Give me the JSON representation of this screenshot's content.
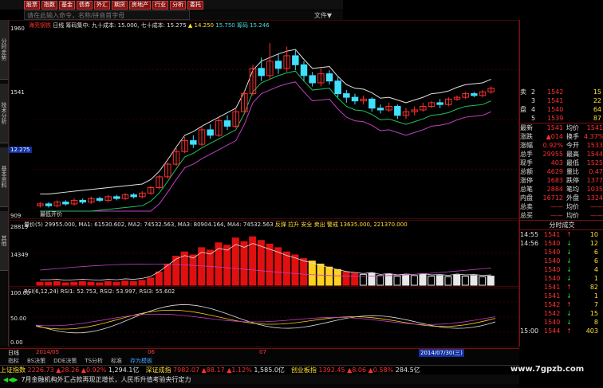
{
  "toolbar": {
    "buttons": [
      "股票",
      "指数",
      "基金",
      "债券",
      "外汇",
      "期货",
      "房地产",
      "行业",
      "分析",
      "委托"
    ],
    "command_placeholder": "请在此输入命令，名称/拼音首字母",
    "file_menu": "文件▼"
  },
  "left_tabs": [
    "分时走势",
    "技术分析",
    "基本资料",
    "其他"
  ],
  "main_chart": {
    "stock_name": "海亮钢铁",
    "period": "日线",
    "indicator_line": "筹码集中: 九十成本: 15.000, 七十成本: 15.275",
    "hi_label": "▲ 14.250",
    "values_line": "15.750 筹码 15.246",
    "y_top": "1960",
    "y_mid": "1541",
    "y_cur": "12.275",
    "y_bottom": "909",
    "bottom_hint": "最低开价",
    "candles": [
      {
        "o": 9.6,
        "c": 9.7,
        "h": 9.8,
        "l": 9.5
      },
      {
        "o": 9.7,
        "c": 9.6,
        "h": 9.8,
        "l": 9.5
      },
      {
        "o": 9.6,
        "c": 9.8,
        "h": 9.9,
        "l": 9.5
      },
      {
        "o": 9.8,
        "c": 9.7,
        "h": 9.9,
        "l": 9.6
      },
      {
        "o": 9.7,
        "c": 9.9,
        "h": 10.0,
        "l": 9.6
      },
      {
        "o": 9.9,
        "c": 9.8,
        "h": 10.0,
        "l": 9.7
      },
      {
        "o": 9.8,
        "c": 10.0,
        "h": 10.1,
        "l": 9.7
      },
      {
        "o": 10.0,
        "c": 9.9,
        "h": 10.1,
        "l": 9.8
      },
      {
        "o": 9.9,
        "c": 10.1,
        "h": 10.2,
        "l": 9.8
      },
      {
        "o": 10.1,
        "c": 10.0,
        "h": 10.2,
        "l": 9.9
      },
      {
        "o": 10.0,
        "c": 10.2,
        "h": 10.3,
        "l": 9.9
      },
      {
        "o": 10.2,
        "c": 10.1,
        "h": 10.3,
        "l": 10.0
      },
      {
        "o": 10.1,
        "c": 10.3,
        "h": 10.4,
        "l": 10.0
      },
      {
        "o": 10.3,
        "c": 10.6,
        "h": 10.7,
        "l": 10.2
      },
      {
        "o": 10.6,
        "c": 11.2,
        "h": 11.3,
        "l": 10.5
      },
      {
        "o": 11.2,
        "c": 11.9,
        "h": 12.0,
        "l": 11.1
      },
      {
        "o": 11.9,
        "c": 12.6,
        "h": 12.8,
        "l": 11.8
      },
      {
        "o": 12.6,
        "c": 13.2,
        "h": 13.4,
        "l": 12.5
      },
      {
        "o": 13.2,
        "c": 13.0,
        "h": 13.5,
        "l": 12.8
      },
      {
        "o": 13.0,
        "c": 13.8,
        "h": 14.0,
        "l": 12.9
      },
      {
        "o": 13.8,
        "c": 13.5,
        "h": 14.1,
        "l": 13.3
      },
      {
        "o": 13.5,
        "c": 14.3,
        "h": 14.5,
        "l": 13.4
      },
      {
        "o": 14.3,
        "c": 14.0,
        "h": 14.6,
        "l": 13.8
      },
      {
        "o": 14.0,
        "c": 14.8,
        "h": 15.0,
        "l": 13.9
      },
      {
        "o": 14.8,
        "c": 15.8,
        "h": 16.0,
        "l": 14.7
      },
      {
        "o": 15.8,
        "c": 17.2,
        "h": 17.4,
        "l": 15.7
      },
      {
        "o": 17.2,
        "c": 16.8,
        "h": 17.8,
        "l": 16.5
      },
      {
        "o": 16.8,
        "c": 17.6,
        "h": 18.6,
        "l": 16.6
      },
      {
        "o": 17.6,
        "c": 17.2,
        "h": 18.0,
        "l": 16.9
      },
      {
        "o": 17.2,
        "c": 17.9,
        "h": 18.4,
        "l": 17.0
      },
      {
        "o": 17.9,
        "c": 17.4,
        "h": 18.2,
        "l": 17.1
      },
      {
        "o": 17.4,
        "c": 16.8,
        "h": 17.6,
        "l": 16.5
      },
      {
        "o": 16.8,
        "c": 16.4,
        "h": 17.0,
        "l": 16.2
      },
      {
        "o": 16.4,
        "c": 16.9,
        "h": 17.2,
        "l": 16.2
      },
      {
        "o": 16.9,
        "c": 16.5,
        "h": 17.1,
        "l": 16.3
      },
      {
        "o": 16.5,
        "c": 15.8,
        "h": 16.7,
        "l": 15.6
      },
      {
        "o": 15.8,
        "c": 15.6,
        "h": 16.0,
        "l": 15.3
      },
      {
        "o": 15.6,
        "c": 15.4,
        "h": 15.8,
        "l": 15.2
      },
      {
        "o": 15.4,
        "c": 15.5,
        "h": 15.7,
        "l": 15.2
      },
      {
        "o": 15.5,
        "c": 15.0,
        "h": 15.6,
        "l": 14.8
      },
      {
        "o": 15.0,
        "c": 14.9,
        "h": 15.2,
        "l": 14.7
      },
      {
        "o": 14.9,
        "c": 15.1,
        "h": 15.3,
        "l": 14.8
      },
      {
        "o": 15.1,
        "c": 14.6,
        "h": 15.2,
        "l": 14.4
      },
      {
        "o": 14.6,
        "c": 14.8,
        "h": 15.0,
        "l": 14.4
      },
      {
        "o": 14.8,
        "c": 14.9,
        "h": 15.1,
        "l": 14.6
      },
      {
        "o": 14.9,
        "c": 15.1,
        "h": 15.3,
        "l": 14.8
      },
      {
        "o": 15.1,
        "c": 15.3,
        "h": 15.4,
        "l": 15.0
      },
      {
        "o": 15.3,
        "c": 15.2,
        "h": 15.5,
        "l": 15.0
      },
      {
        "o": 15.2,
        "c": 15.5,
        "h": 15.6,
        "l": 15.1
      },
      {
        "o": 15.5,
        "c": 15.6,
        "h": 15.7,
        "l": 15.4
      },
      {
        "o": 15.6,
        "c": 15.8,
        "h": 15.9,
        "l": 15.5
      },
      {
        "o": 15.8,
        "c": 15.7,
        "h": 15.9,
        "l": 15.6
      },
      {
        "o": 15.7,
        "c": 15.9,
        "h": 16.0,
        "l": 15.6
      },
      {
        "o": 15.9,
        "c": 16.1,
        "h": 16.2,
        "l": 15.8
      }
    ]
  },
  "volume_panel": {
    "header": "量价(5) 29955.000, MA1: 61530.602, MA2: 74532.563, MA3: 80904.164, MA4: 74532.563",
    "extra": "反弹 拉升 安全 卖出 警戒 13635.000, 221370.000",
    "y_top": "28819",
    "y_mid": "14349",
    "bars": [
      0.05,
      0.05,
      0.06,
      0.04,
      0.05,
      0.06,
      0.05,
      0.04,
      0.06,
      0.05,
      0.07,
      0.06,
      0.08,
      0.12,
      0.22,
      0.35,
      0.48,
      0.55,
      0.5,
      0.62,
      0.58,
      0.7,
      0.66,
      0.78,
      0.72,
      0.8,
      0.74,
      0.68,
      0.62,
      0.55,
      0.5,
      0.44,
      0.4,
      0.35,
      0.3,
      0.26,
      0.22,
      0.2,
      0.18,
      0.2,
      0.16,
      0.18,
      0.15,
      0.17,
      0.16,
      0.18,
      0.15,
      0.16,
      0.14,
      0.17,
      0.15,
      0.16,
      0.14,
      0.15
    ]
  },
  "rsi_panel": {
    "header": "RSI(6,12,24) RSI1: 52.753, RSI2: 53.997, RSI3: 55.602",
    "y_top": "100.00",
    "y_mid": "50.00",
    "y_bot": "0.00"
  },
  "time_axis": {
    "period": "日线",
    "labels": [
      "2014/05",
      "06",
      "07"
    ],
    "date": "2014/07/30(三)"
  },
  "tabs_row": [
    "指标",
    "BS决策",
    "DDE决策",
    "TS分析",
    "标准",
    "存为模板"
  ],
  "order_book": [
    {
      "side": "卖",
      "lvl": "2",
      "price": "1542",
      "vol": "15"
    },
    {
      "side": "",
      "lvl": "3",
      "price": "1541",
      "vol": "22"
    },
    {
      "side": "盘",
      "lvl": "4",
      "price": "1540",
      "vol": "64"
    },
    {
      "side": "",
      "lvl": "5",
      "price": "1539",
      "vol": "87"
    }
  ],
  "quote": [
    {
      "k1": "最新",
      "v1": "1541",
      "k2": "均价",
      "v2": "1541"
    },
    {
      "k1": "涨跌",
      "v1": "▲014",
      "k2": "换手",
      "v2": "4.37%"
    },
    {
      "k1": "涨幅",
      "v1": "0.92%",
      "k2": "今开",
      "v2": "1533"
    },
    {
      "k1": "总手",
      "v1": "29955",
      "k2": "最高",
      "v2": "1544"
    },
    {
      "k1": "现手",
      "v1": "403",
      "k2": "最低",
      "v2": "1525"
    },
    {
      "k1": "总额",
      "v1": "4629",
      "k2": "量比",
      "v2": "0.47"
    },
    {
      "k1": "涨停",
      "v1": "1683",
      "k2": "跌停",
      "v2": "1377"
    },
    {
      "k1": "总笔",
      "v1": "2884",
      "k2": "笔均",
      "v2": "1035"
    },
    {
      "k1": "内盘",
      "v1": "16712",
      "k2": "外盘",
      "v2": "1324"
    },
    {
      "k1": "总卖",
      "v1": "——",
      "k2": "均价",
      "v2": "——"
    },
    {
      "k1": "总买",
      "v1": "——",
      "k2": "均价",
      "v2": "——"
    }
  ],
  "ticks_title": "分时成交",
  "ticks": [
    {
      "t": "14:55",
      "p": "1541",
      "a": "↑",
      "v": "10"
    },
    {
      "t": "14:56",
      "p": "1540",
      "a": "↓",
      "v": "12"
    },
    {
      "t": "",
      "p": "1540",
      "a": "↓",
      "v": "6"
    },
    {
      "t": "",
      "p": "1540",
      "a": "↓",
      "v": "6"
    },
    {
      "t": "",
      "p": "1540",
      "a": "↓",
      "v": "4"
    },
    {
      "t": "",
      "p": "1540",
      "a": "↓",
      "v": "1"
    },
    {
      "t": "",
      "p": "1541",
      "a": "↑",
      "v": "82"
    },
    {
      "t": "",
      "p": "1541",
      "a": "↓",
      "v": "1"
    },
    {
      "t": "",
      "p": "1542",
      "a": "↑",
      "v": "7"
    },
    {
      "t": "",
      "p": "1542",
      "a": "↓",
      "v": "15"
    },
    {
      "t": "",
      "p": "1540",
      "a": "↓",
      "v": "8"
    },
    {
      "t": "15:00",
      "p": "1544",
      "a": "↑",
      "v": "403"
    }
  ],
  "index_bar": [
    {
      "name": "上证指数",
      "val": "2226.73",
      "chg": "▲28.26",
      "pct": "▲0.92%",
      "amt": "1,294.1亿"
    },
    {
      "name": "深证成指",
      "val": "7982.07",
      "chg": "▲88.17",
      "pct": "▲1.12%",
      "amt": "1,585.0亿"
    },
    {
      "name": "创业板指",
      "val": "1392.45",
      "chg": "▲8.06",
      "pct": "▲0.58%",
      "amt": "284.5亿"
    }
  ],
  "news": "7月金融机构外汇占款再现正增长，人民币升值考验央行定力",
  "watermark": "www.7gpzb.com"
}
